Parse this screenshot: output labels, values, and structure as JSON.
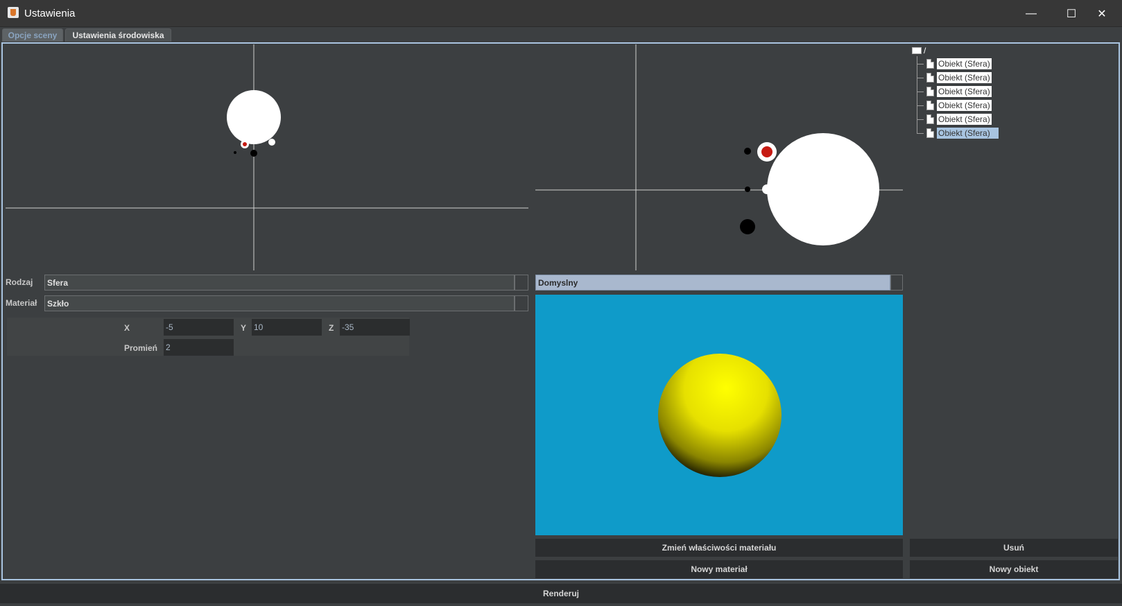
{
  "window": {
    "title": "Ustawienia",
    "controls": {
      "minimize": "—",
      "maximize": "☐",
      "close": "✕"
    }
  },
  "tabs": [
    {
      "label": "Opcje sceny"
    },
    {
      "label": "Ustawienia środowiska"
    }
  ],
  "properties": {
    "type_label": "Rodzaj",
    "type_value": "Sfera",
    "material_label": "Materiał",
    "material_value": "Szkło",
    "x_label": "X",
    "x_value": "-5",
    "y_label": "Y",
    "y_value": "10",
    "z_label": "Z",
    "z_value": "-35",
    "radius_label": "Promień",
    "radius_value": "2"
  },
  "material_panel": {
    "selected": "Domyslny",
    "change_button": "Zmień właściwości materiału",
    "new_button": "Nowy materiał",
    "preview_bg": "#0f9bc9",
    "sphere_color": "#ffff00"
  },
  "tree": {
    "root": "/",
    "items": [
      "Obiekt (Sfera)",
      "Obiekt (Sfera)",
      "Obiekt (Sfera)",
      "Obiekt (Sfera)",
      "Obiekt (Sfera)",
      "Obiekt (Sfera)"
    ],
    "selected_index": 5,
    "delete_button": "Usuń",
    "new_button": "Nowy obiekt"
  },
  "render_button": "Renderuj"
}
